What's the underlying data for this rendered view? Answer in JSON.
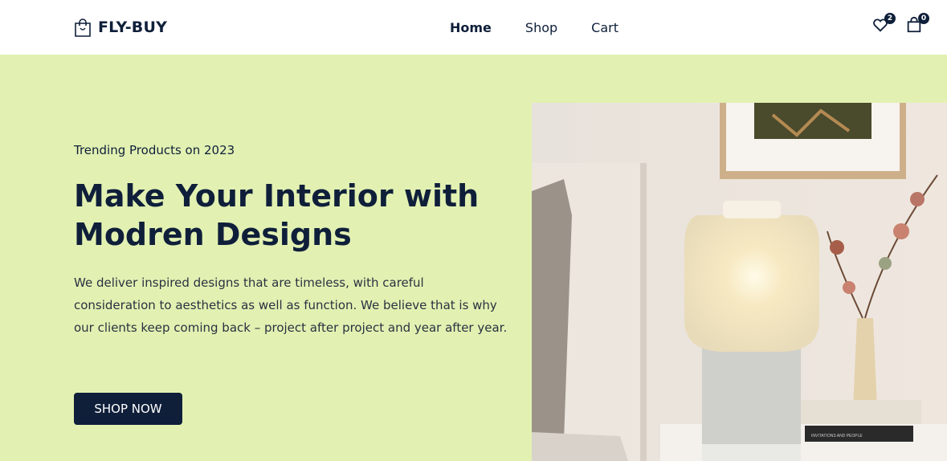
{
  "brand": {
    "name": "FLY-BUY",
    "logo_icon": "shopping-bag-icon"
  },
  "nav": {
    "items": [
      "Home",
      "Shop",
      "Cart"
    ],
    "active": "Home"
  },
  "header_icons": {
    "wishlist": {
      "icon": "heart-icon",
      "count": "2"
    },
    "cart": {
      "icon": "bag-icon",
      "count": "0"
    }
  },
  "hero": {
    "eyebrow": "Trending Products on 2023",
    "title": "Make Your Interior with Modren Designs",
    "description": "We deliver inspired designs that are timeless, with careful consideration to aesthetics as well as function. We believe that is why our clients keep coming back – project after project and year after year.",
    "cta_label": "SHOP NOW",
    "image_book_text": "INVITATIONS AND PEOPLE"
  },
  "colors": {
    "hero_bg": "#e2f1b2",
    "primary": "#0f1f3a",
    "header_bg": "#ffffff"
  }
}
